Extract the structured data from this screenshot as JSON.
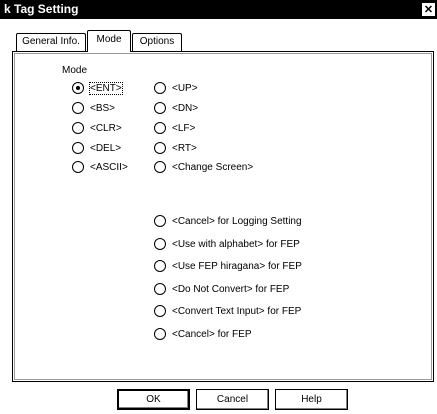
{
  "window": {
    "title": "k Tag Setting",
    "close_glyph": "✕"
  },
  "tabs": [
    {
      "label": "General Info."
    },
    {
      "label": "Mode",
      "active": true
    },
    {
      "label": "Options"
    }
  ],
  "mode_section": {
    "label": "Mode"
  },
  "left_options": [
    {
      "label": "<ENT>",
      "checked": true
    },
    {
      "label": "<BS>"
    },
    {
      "label": "<CLR>"
    },
    {
      "label": "<DEL>"
    },
    {
      "label": "<ASCII>"
    }
  ],
  "right_options": [
    {
      "label": "<UP>"
    },
    {
      "label": "<DN>"
    },
    {
      "label": "<LF>"
    },
    {
      "label": "<RT>"
    },
    {
      "label": "<Change Screen>"
    }
  ],
  "lower_options": [
    {
      "label": "<Cancel> for Logging Setting"
    },
    {
      "label": "<Use with alphabet> for FEP"
    },
    {
      "label": "<Use FEP hiragana> for FEP"
    },
    {
      "label": "<Do Not Convert> for FEP"
    },
    {
      "label": "<Convert Text Input> for FEP"
    },
    {
      "label": "<Cancel> for FEP"
    }
  ],
  "buttons": {
    "ok": "OK",
    "cancel": "Cancel",
    "help": "Help"
  }
}
